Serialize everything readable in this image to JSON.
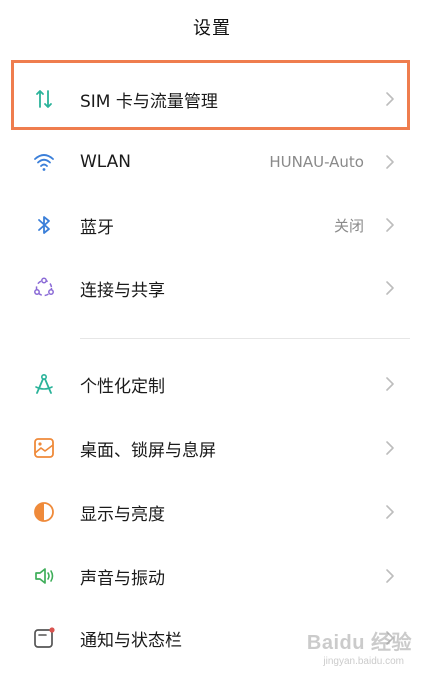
{
  "header": {
    "title": "设置"
  },
  "items": [
    {
      "label": "SIM 卡与流量管理",
      "value": "",
      "icon": "sim-data-icon",
      "color": "#2bb39a"
    },
    {
      "label": "WLAN",
      "value": "HUNAU-Auto",
      "icon": "wifi-icon",
      "color": "#3b7fd9"
    },
    {
      "label": "蓝牙",
      "value": "关闭",
      "icon": "bluetooth-icon",
      "color": "#3b7fd9"
    },
    {
      "label": "连接与共享",
      "value": "",
      "icon": "share-icon",
      "color": "#8a6ad6"
    },
    {
      "label": "个性化定制",
      "value": "",
      "icon": "compass-icon",
      "color": "#2bb39a"
    },
    {
      "label": "桌面、锁屏与息屏",
      "value": "",
      "icon": "wallpaper-icon",
      "color": "#ef8a3a"
    },
    {
      "label": "显示与亮度",
      "value": "",
      "icon": "brightness-icon",
      "color": "#ef8a3a"
    },
    {
      "label": "声音与振动",
      "value": "",
      "icon": "sound-icon",
      "color": "#3fae5a"
    },
    {
      "label": "通知与状态栏",
      "value": "",
      "icon": "notification-icon",
      "color": "#d9534f"
    }
  ],
  "highlight_color": "#ef7d4e",
  "watermark": {
    "brand": "Baidu 经验",
    "url": "jingyan.baidu.com"
  }
}
